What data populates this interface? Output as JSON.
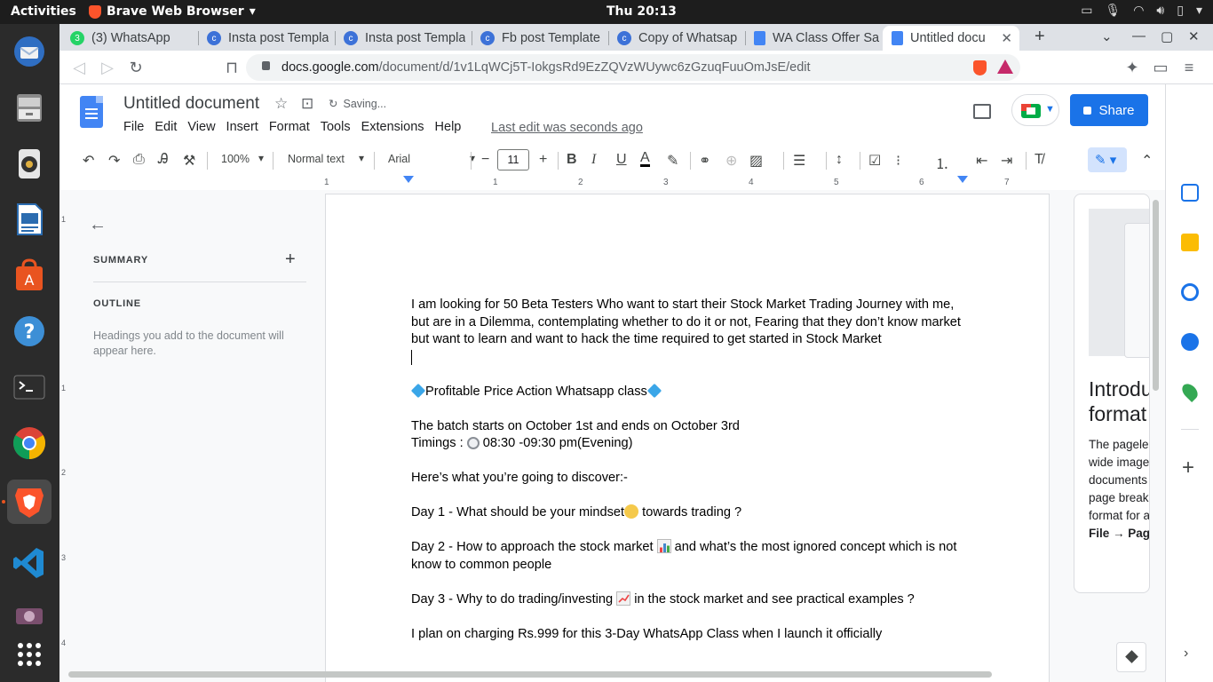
{
  "system": {
    "activities": "Activities",
    "app_name": "Brave Web Browser",
    "clock": "Thu 20:13"
  },
  "browser": {
    "tabs": [
      {
        "title": "(3) WhatsApp",
        "badge": "3",
        "active": false
      },
      {
        "title": "Insta post Templa",
        "active": false
      },
      {
        "title": "Insta post Templa",
        "active": false
      },
      {
        "title": "Fb post Template",
        "active": false
      },
      {
        "title": "Copy of Whatsap",
        "active": false
      },
      {
        "title": "WA Class Offer Sa",
        "active": false
      },
      {
        "title": "Untitled docu",
        "active": true
      }
    ],
    "url_host": "docs.google.com",
    "url_path": "/document/d/1v1LqWCj5T-IokgsRd9EzZQVzWUywc6zGzuqFuuOmJsE/edit"
  },
  "docs": {
    "title": "Untitled document",
    "status": "Saving...",
    "menu": [
      "File",
      "Edit",
      "View",
      "Insert",
      "Format",
      "Tools",
      "Extensions",
      "Help"
    ],
    "last_edit": "Last edit was seconds ago",
    "share_label": "Share",
    "toolbar": {
      "zoom": "100%",
      "style": "Normal text",
      "font": "Arial",
      "font_size": "11"
    },
    "ruler_numbers": [
      "1",
      "1",
      "2",
      "3",
      "4",
      "5",
      "6",
      "7"
    ],
    "vruler_numbers": [
      "1",
      "1",
      "2",
      "3",
      "4"
    ],
    "outline": {
      "summary_label": "SUMMARY",
      "outline_label": "OUTLINE",
      "hint": "Headings you add to the document will appear here."
    },
    "body": {
      "p1": "I am looking for 50 Beta Testers Who want to start their Stock Market Trading Journey with me, but are in a Dilemma, contemplating whether to do it or not, Fearing that they don’t know market but want to learn and want to hack the time required to get started in Stock Market",
      "heading": "Profitable Price Action Whatsapp class",
      "batch": "The batch starts on October 1st and ends on October 3rd",
      "timings_prefix": "Timings : ",
      "timings_value": " 08:30 -09:30 pm(Evening)",
      "discover": "Here’s what you’re going to discover:-",
      "day1_a": "Day 1 - What should be your mindset",
      "day1_b": " towards trading ?",
      "day2_a": "Day 2 - How to approach the stock market ",
      "day2_b": " and what’s the most ignored concept which is not know to common people",
      "day3_a": "Day 3 - Why to do trading/investing ",
      "day3_b": " in the stock market and see practical examples ?",
      "pricing": "I plan on charging Rs.999 for this 3-Day WhatsApp Class when I launch it officially"
    },
    "explore": {
      "intro_title_1": "Introdu",
      "intro_title_2": "format",
      "desc": [
        "The pagele",
        "wide image",
        "documents",
        "page break",
        "format for a"
      ],
      "desc_bold": "File → Pag"
    }
  }
}
